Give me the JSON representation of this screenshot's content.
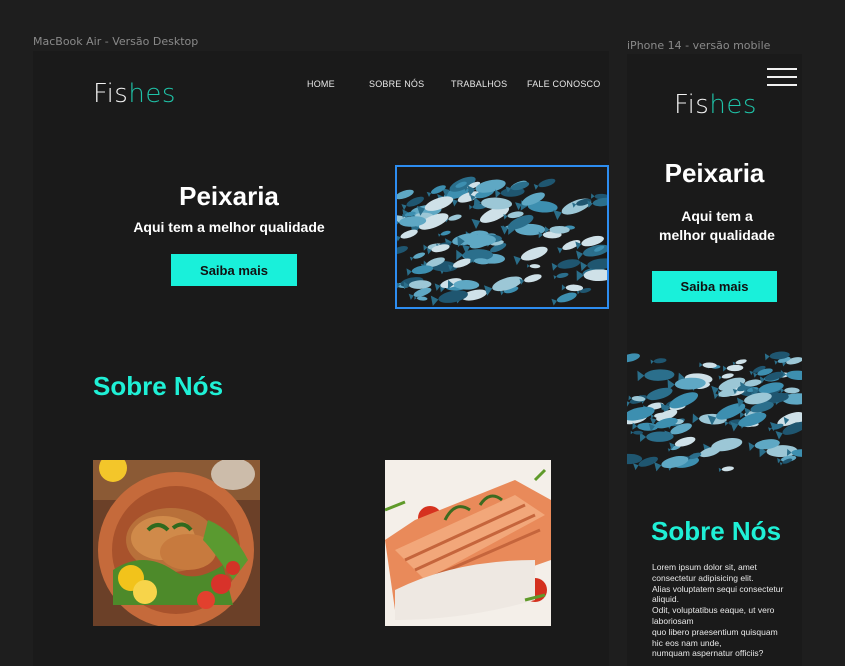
{
  "frames": {
    "desktop_label": "MacBook Air - Versão Desktop",
    "mobile_label": "iPhone 14 - versão mobile"
  },
  "brand": {
    "logo_part1": "Fis",
    "logo_part2": "hes",
    "accent_color": "#19f0da",
    "logo_accent_color": "#1fc3a8"
  },
  "nav": {
    "items": [
      {
        "label": "HOME"
      },
      {
        "label": "SOBRE NÓS"
      },
      {
        "label": "TRABALHOS"
      },
      {
        "label": "FALE CONOSCO"
      }
    ]
  },
  "hero": {
    "title": "Peixaria",
    "subtitle": "Aqui tem a melhor qualidade",
    "mobile_subtitle_line1": "Aqui tem a",
    "mobile_subtitle_line2": "melhor qualidade",
    "cta_label": "Saiba mais"
  },
  "about": {
    "title": "Sobre Nós",
    "text_lines": [
      "Lorem ipsum dolor sit, amet",
      "consectetur adipisicing elit.",
      "Alias voluptatem sequi consectetur",
      "aliquid.",
      "Odit, voluptatibus eaque, ut vero",
      "laboriosam",
      "quo libero praesentium quisquam",
      "hic eos nam unde,",
      "numquam aspernatur officiis?"
    ]
  },
  "icons": {
    "menu": "hamburger-menu-icon"
  }
}
